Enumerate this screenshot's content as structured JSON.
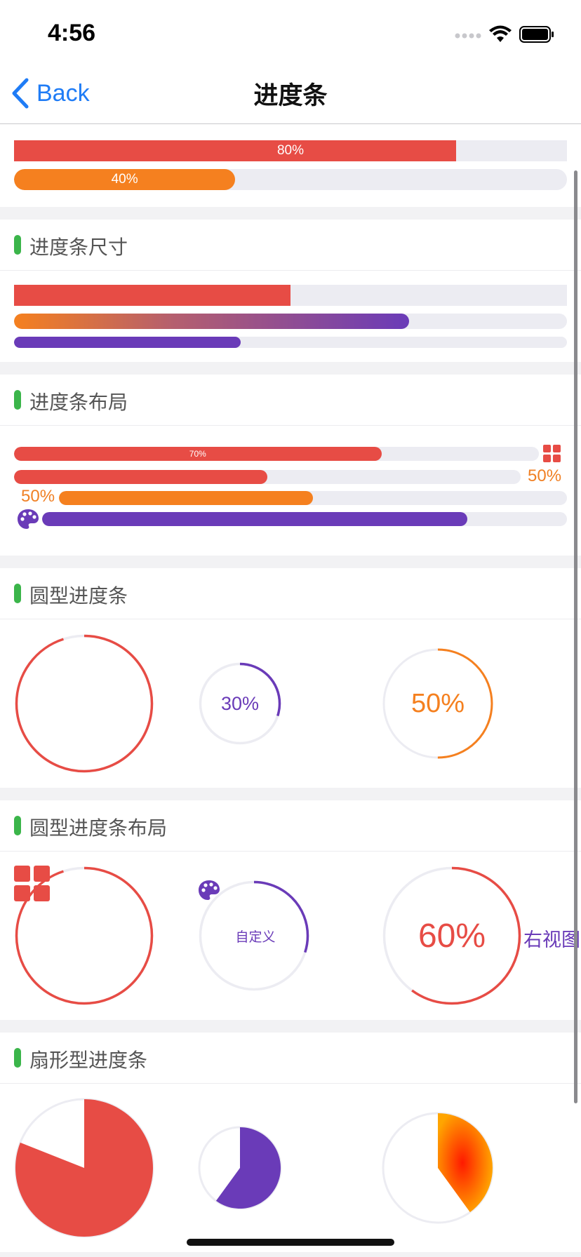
{
  "status": {
    "time": "4:56"
  },
  "nav": {
    "back_label": "Back",
    "title": "进度条"
  },
  "top": {
    "bar1_label": "80%",
    "bar1_progress": 0.8,
    "bar2_label": "40%",
    "bar2_progress": 0.4
  },
  "sections": {
    "size": {
      "title": "进度条尺寸",
      "bar1_progress": 0.5,
      "bar2_progress": 0.714,
      "bar3_progress": 0.41
    },
    "layout": {
      "title": "进度条布局",
      "bar1_label": "70%",
      "bar1_progress": 0.7,
      "bar2_right_label": "50%",
      "bar2_progress": 0.5,
      "bar3_left_label": "50%",
      "bar3_progress": 0.5,
      "bar4_progress": 0.81
    },
    "circle": {
      "title": "圆型进度条",
      "ring1_progress": 0.95,
      "ring2_label": "30%",
      "ring2_progress": 0.3,
      "ring3_label": "50%",
      "ring3_progress": 0.5
    },
    "circle_layout": {
      "title": "圆型进度条布局",
      "ring1_progress": 0.95,
      "ring2_label": "自定义",
      "ring2_progress": 0.3,
      "ring3_label": "60%",
      "ring3_progress": 0.6,
      "ring3_right_label": "右视图"
    },
    "pie": {
      "title": "扇形型进度条",
      "pie1_progress": 0.81,
      "pie2_progress": 0.6,
      "pie3_progress": 0.4
    }
  },
  "colors": {
    "red": "#e74c45",
    "orange": "#f5801f",
    "purple": "#6a3bb8",
    "track": "#ececf2",
    "accent_green": "#3bb54a",
    "link_blue": "#1f7cf6"
  },
  "icons": {
    "back": "chevron-left-icon",
    "grid": "grid-icon",
    "palette": "palette-icon",
    "signal": "signal-icon",
    "wifi": "wifi-icon",
    "battery": "battery-icon"
  }
}
